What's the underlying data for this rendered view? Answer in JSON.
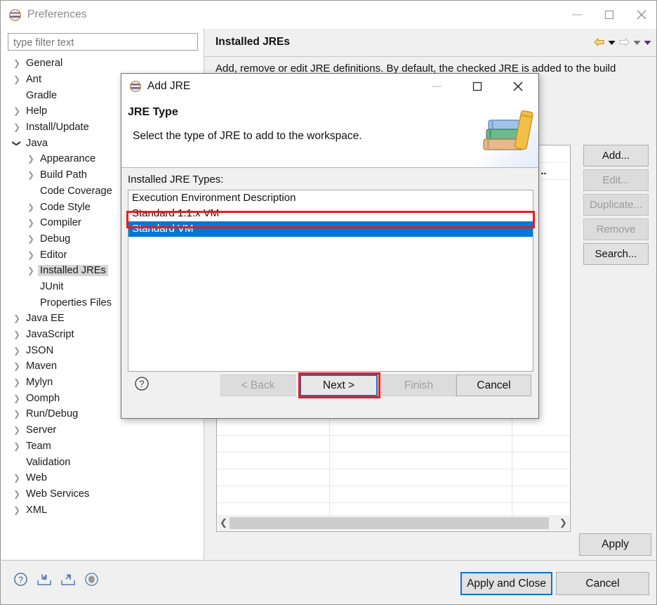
{
  "preferences": {
    "title": "Preferences",
    "filter_placeholder": "type filter text",
    "filter_value": "",
    "tree": [
      {
        "label": "General",
        "depth": 0,
        "arrow": "collapsed",
        "selected": false
      },
      {
        "label": "Ant",
        "depth": 0,
        "arrow": "collapsed",
        "selected": false
      },
      {
        "label": "Gradle",
        "depth": 0,
        "arrow": "none",
        "selected": false
      },
      {
        "label": "Help",
        "depth": 0,
        "arrow": "collapsed",
        "selected": false
      },
      {
        "label": "Install/Update",
        "depth": 0,
        "arrow": "collapsed",
        "selected": false
      },
      {
        "label": "Java",
        "depth": 0,
        "arrow": "expanded",
        "selected": false
      },
      {
        "label": "Appearance",
        "depth": 1,
        "arrow": "collapsed",
        "selected": false
      },
      {
        "label": "Build Path",
        "depth": 1,
        "arrow": "collapsed",
        "selected": false
      },
      {
        "label": "Code Coverage",
        "depth": 1,
        "arrow": "none",
        "selected": false
      },
      {
        "label": "Code Style",
        "depth": 1,
        "arrow": "collapsed",
        "selected": false
      },
      {
        "label": "Compiler",
        "depth": 1,
        "arrow": "collapsed",
        "selected": false
      },
      {
        "label": "Debug",
        "depth": 1,
        "arrow": "collapsed",
        "selected": false
      },
      {
        "label": "Editor",
        "depth": 1,
        "arrow": "collapsed",
        "selected": false
      },
      {
        "label": "Installed JREs",
        "depth": 1,
        "arrow": "collapsed",
        "selected": true
      },
      {
        "label": "JUnit",
        "depth": 1,
        "arrow": "none",
        "selected": false
      },
      {
        "label": "Properties Files",
        "depth": 1,
        "arrow": "none",
        "selected": false
      },
      {
        "label": "Java EE",
        "depth": 0,
        "arrow": "collapsed",
        "selected": false
      },
      {
        "label": "JavaScript",
        "depth": 0,
        "arrow": "collapsed",
        "selected": false
      },
      {
        "label": "JSON",
        "depth": 0,
        "arrow": "collapsed",
        "selected": false
      },
      {
        "label": "Maven",
        "depth": 0,
        "arrow": "collapsed",
        "selected": false
      },
      {
        "label": "Mylyn",
        "depth": 0,
        "arrow": "collapsed",
        "selected": false
      },
      {
        "label": "Oomph",
        "depth": 0,
        "arrow": "collapsed",
        "selected": false
      },
      {
        "label": "Run/Debug",
        "depth": 0,
        "arrow": "collapsed",
        "selected": false
      },
      {
        "label": "Server",
        "depth": 0,
        "arrow": "collapsed",
        "selected": false
      },
      {
        "label": "Team",
        "depth": 0,
        "arrow": "collapsed",
        "selected": false
      },
      {
        "label": "Validation",
        "depth": 0,
        "arrow": "none",
        "selected": false
      },
      {
        "label": "Web",
        "depth": 0,
        "arrow": "collapsed",
        "selected": false
      },
      {
        "label": "Web Services",
        "depth": 0,
        "arrow": "collapsed",
        "selected": false
      },
      {
        "label": "XML",
        "depth": 0,
        "arrow": "collapsed",
        "selected": false
      }
    ],
    "page": {
      "title": "Installed JREs",
      "description": "Add, remove or edit JRE definitions. By default, the checked JRE is added to the build",
      "table_row_text": "dard .."
    },
    "side_buttons": [
      {
        "label": "Add...",
        "disabled": false
      },
      {
        "label": "Edit...",
        "disabled": true
      },
      {
        "label": "Duplicate...",
        "disabled": true
      },
      {
        "label": "Remove",
        "disabled": true
      },
      {
        "label": "Search...",
        "disabled": false
      }
    ],
    "apply_label": "Apply",
    "footer": {
      "apply_and_close_label": "Apply and Close",
      "cancel_label": "Cancel"
    }
  },
  "dialog": {
    "title": "Add JRE",
    "heading": "JRE Type",
    "description": "Select the type of JRE to add to the workspace.",
    "list_label": "Installed JRE Types:",
    "list_items": [
      {
        "label": "Execution Environment Description",
        "selected": false
      },
      {
        "label": "Standard 1.1.x VM",
        "selected": false
      },
      {
        "label": "Standard VM",
        "selected": true
      }
    ],
    "buttons": [
      {
        "label": "< Back",
        "disabled": true,
        "focused": false
      },
      {
        "label": "Next >",
        "disabled": false,
        "focused": true
      },
      {
        "label": "Finish",
        "disabled": true,
        "focused": false
      },
      {
        "label": "Cancel",
        "disabled": false,
        "focused": false
      }
    ]
  },
  "colors": {
    "selection_blue": "#0078d7",
    "focus_blue": "#0a74cd",
    "annotation_red": "#ee1c1c",
    "window_bg": "#f0f0f0"
  }
}
